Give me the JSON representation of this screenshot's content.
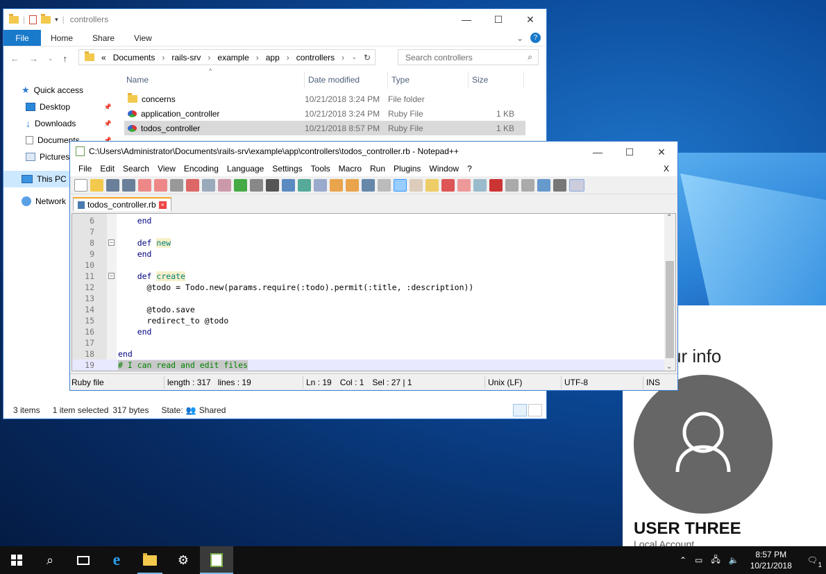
{
  "explorer": {
    "title": "controllers",
    "ribbon": {
      "file": "File",
      "tabs": [
        "Home",
        "Share",
        "View"
      ]
    },
    "address": {
      "prefix": "«",
      "crumbs": [
        "Documents",
        "rails-srv",
        "example",
        "app",
        "controllers"
      ]
    },
    "search_placeholder": "Search controllers",
    "nav": [
      {
        "label": "Quick access"
      },
      {
        "label": "Desktop"
      },
      {
        "label": "Downloads"
      },
      {
        "label": "Documents"
      },
      {
        "label": "Pictures"
      },
      {
        "label": "This PC"
      },
      {
        "label": "Network"
      }
    ],
    "columns": {
      "name": "Name",
      "date": "Date modified",
      "type": "Type",
      "size": "Size"
    },
    "files": [
      {
        "name": "concerns",
        "date": "10/21/2018 3:24 PM",
        "type": "File folder",
        "size": ""
      },
      {
        "name": "application_controller",
        "date": "10/21/2018 3:24 PM",
        "type": "Ruby File",
        "size": "1 KB"
      },
      {
        "name": "todos_controller",
        "date": "10/21/2018 8:57 PM",
        "type": "Ruby File",
        "size": "1 KB"
      }
    ],
    "status": {
      "items": "3 items",
      "selected": "1 item selected",
      "bytes": "317 bytes",
      "state_label": "State:",
      "state_value": "Shared"
    }
  },
  "notepad": {
    "title": "C:\\Users\\Administrator\\Documents\\rails-srv\\example\\app\\controllers\\todos_controller.rb - Notepad++",
    "menu": [
      "File",
      "Edit",
      "Search",
      "View",
      "Encoding",
      "Language",
      "Settings",
      "Tools",
      "Macro",
      "Run",
      "Plugins",
      "Window",
      "?"
    ],
    "menu_close": "X",
    "tab": "todos_controller.rb",
    "tab_close": "×",
    "lines": [
      {
        "n": "6",
        "pre": "    ",
        "kw": "end",
        "def": "",
        "rest": ""
      },
      {
        "n": "7",
        "pre": "",
        "kw": "",
        "def": "",
        "rest": ""
      },
      {
        "n": "8",
        "pre": "    ",
        "kw": "def",
        "def": "new",
        "rest": ""
      },
      {
        "n": "9",
        "pre": "    ",
        "kw": "end",
        "def": "",
        "rest": ""
      },
      {
        "n": "10",
        "pre": "",
        "kw": "",
        "def": "",
        "rest": ""
      },
      {
        "n": "11",
        "pre": "    ",
        "kw": "def",
        "def": "create",
        "rest": ""
      },
      {
        "n": "12",
        "pre": "      ",
        "kw": "",
        "def": "",
        "rest": "@todo = Todo.new(params.require(:todo).permit(:title, :description))"
      },
      {
        "n": "13",
        "pre": "",
        "kw": "",
        "def": "",
        "rest": ""
      },
      {
        "n": "14",
        "pre": "      ",
        "kw": "",
        "def": "",
        "rest": "@todo.save"
      },
      {
        "n": "15",
        "pre": "      ",
        "kw": "",
        "def": "",
        "rest": "redirect_to @todo"
      },
      {
        "n": "16",
        "pre": "    ",
        "kw": "end",
        "def": "",
        "rest": ""
      },
      {
        "n": "17",
        "pre": "",
        "kw": "",
        "def": "",
        "rest": ""
      },
      {
        "n": "18",
        "pre": "",
        "kw": "end",
        "def": "",
        "rest": ""
      },
      {
        "n": "19",
        "pre": "",
        "kw": "",
        "def": "",
        "rest": "",
        "comment": "# I can read and edit files"
      }
    ],
    "status": {
      "lang": "Ruby file",
      "length": "length : 317",
      "lines": "lines : 19",
      "ln": "Ln : 19",
      "col": "Col : 1",
      "sel": "Sel : 27 | 1",
      "eol": "Unix (LF)",
      "enc": "UTF-8",
      "mode": "INS"
    }
  },
  "info_panel": {
    "title": "ur info",
    "user": "USER THREE",
    "account": "Local Account"
  },
  "taskbar": {
    "time": "8:57 PM",
    "date": "10/21/2018",
    "notifications": "1"
  },
  "colors": {
    "accent": "#1979ca",
    "taskbar": "#101010",
    "selection": "#cce8ff"
  }
}
